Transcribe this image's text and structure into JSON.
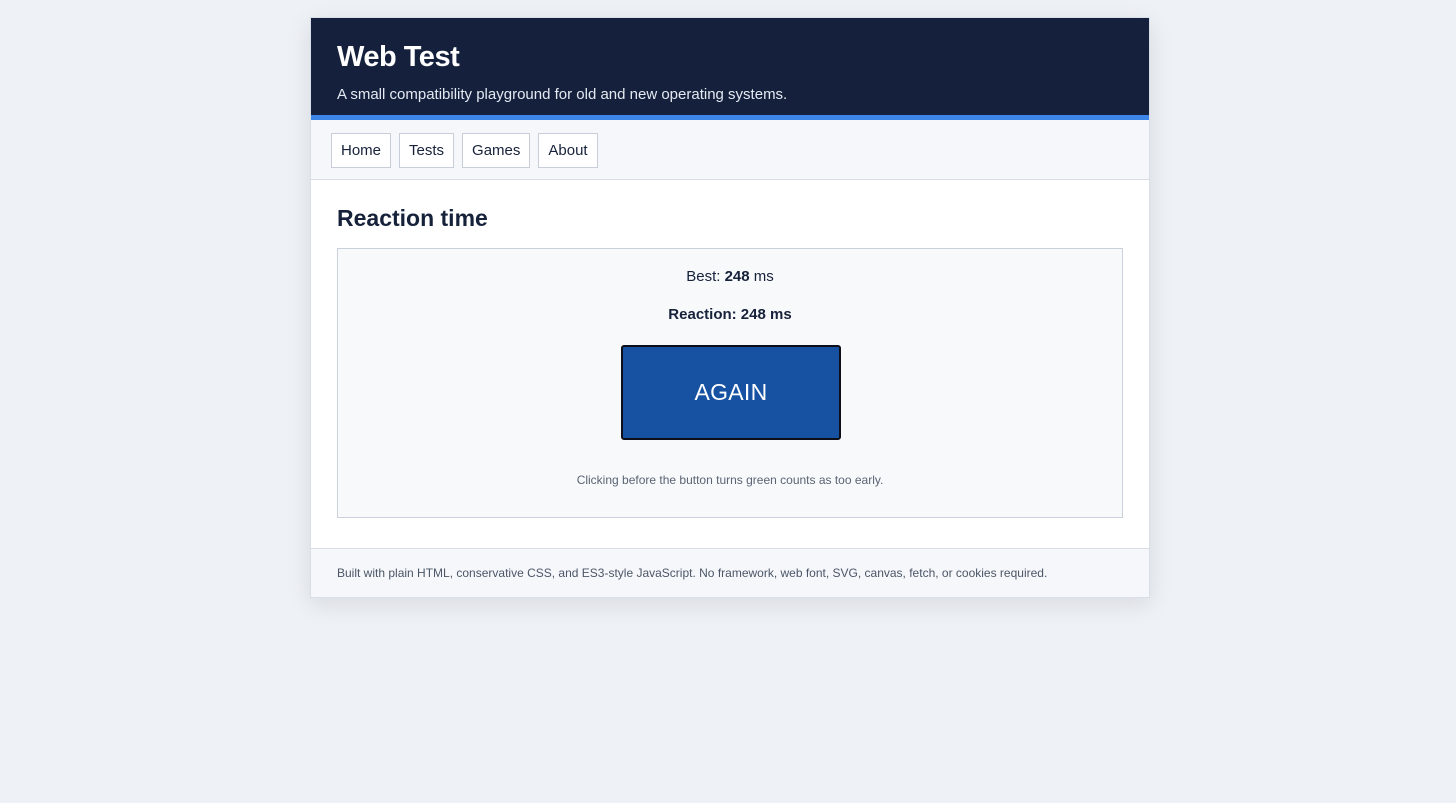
{
  "header": {
    "title": "Web Test",
    "tagline": "A small compatibility playground for old and new operating systems."
  },
  "nav": {
    "items": [
      {
        "label": "Home"
      },
      {
        "label": "Tests"
      },
      {
        "label": "Games"
      },
      {
        "label": "About"
      }
    ]
  },
  "main": {
    "title": "Reaction time",
    "game": {
      "best_prefix": "Best: ",
      "best_value": "248",
      "best_unit": " ms",
      "reaction_text": "Reaction: 248 ms",
      "button_label": "AGAIN",
      "button_color": "#1752a2",
      "hint": "Clicking before the button turns green counts as too early."
    }
  },
  "footer": {
    "text": "Built with plain HTML, conservative CSS, and ES3-style JavaScript. No framework, web font, SVG, canvas, fetch, or cookies required."
  },
  "colors": {
    "header_bg": "#15213c",
    "accent": "#3d86e8",
    "page_bg": "#eef1f5"
  }
}
